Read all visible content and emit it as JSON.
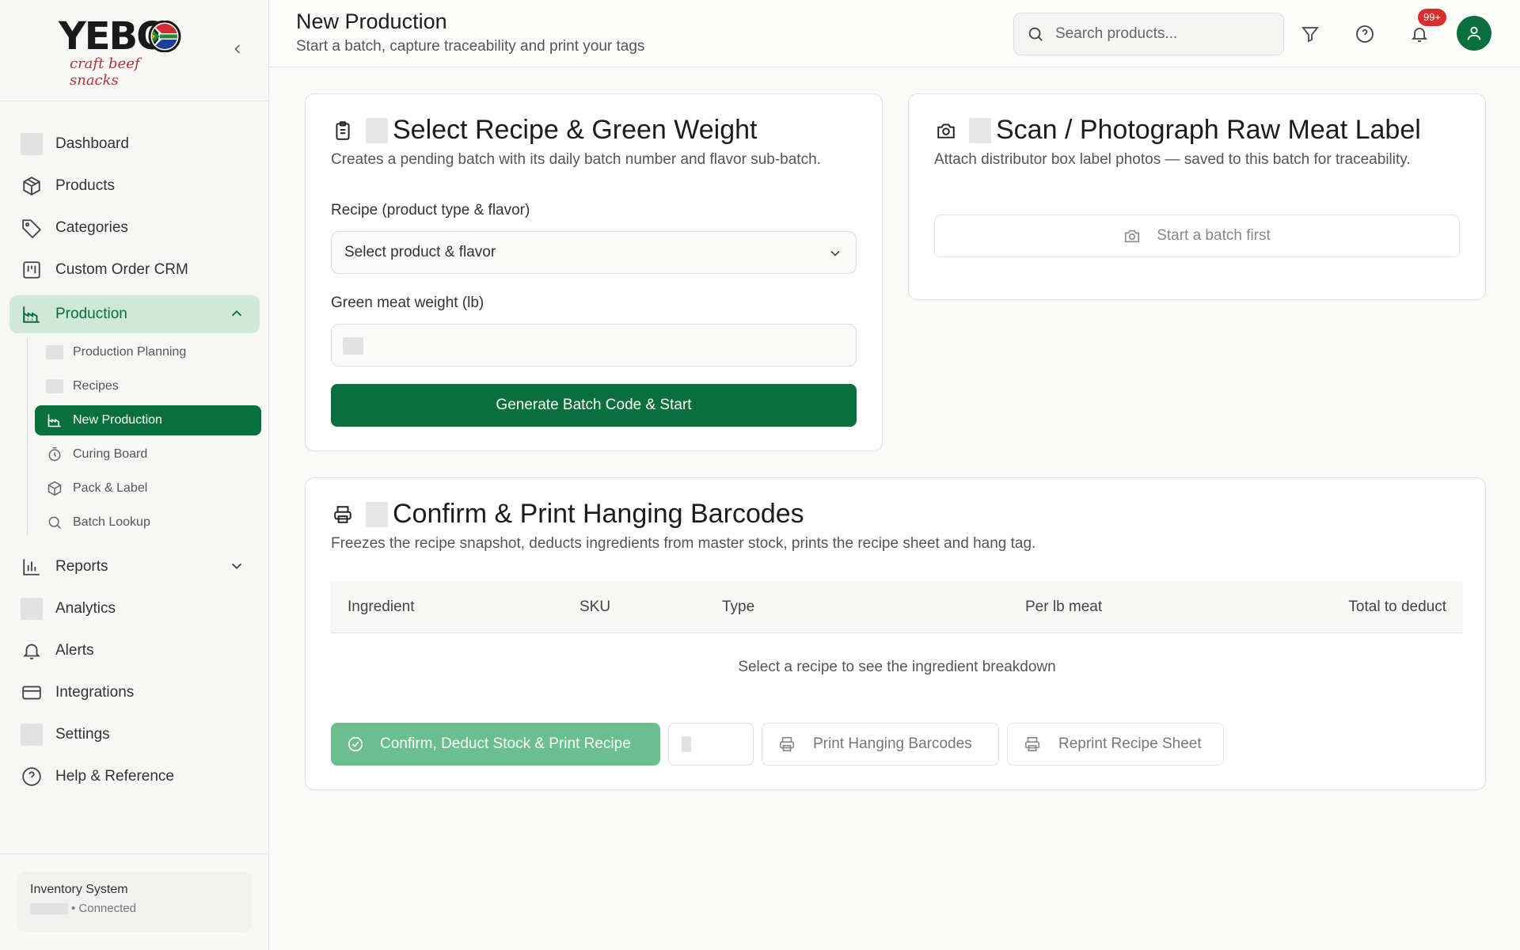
{
  "brand": {
    "wordmark": "YEBO",
    "tagline": "craft beef snacks"
  },
  "sidebar": {
    "items": [
      {
        "label": "Dashboard",
        "icon": "placeholder-icon"
      },
      {
        "label": "Products",
        "icon": "box-icon"
      },
      {
        "label": "Categories",
        "icon": "tag-icon"
      },
      {
        "label": "Custom Order CRM",
        "icon": "kanban-icon"
      },
      {
        "label": "Production",
        "icon": "factory-icon",
        "active": true,
        "expanded": true
      },
      {
        "label": "Reports",
        "icon": "bar-chart-icon"
      },
      {
        "label": "Analytics",
        "icon": "placeholder-icon"
      },
      {
        "label": "Alerts",
        "icon": "bell-icon"
      },
      {
        "label": "Integrations",
        "icon": "card-icon"
      },
      {
        "label": "Settings",
        "icon": "placeholder-icon"
      },
      {
        "label": "Help & Reference",
        "icon": "help-circle-icon"
      }
    ],
    "production_subitems": [
      {
        "label": "Production Planning",
        "icon": "placeholder-icon"
      },
      {
        "label": "Recipes",
        "icon": "placeholder-icon"
      },
      {
        "label": "New Production",
        "icon": "factory-icon",
        "active": true
      },
      {
        "label": "Curing Board",
        "icon": "timer-icon"
      },
      {
        "label": "Pack & Label",
        "icon": "package-icon"
      },
      {
        "label": "Batch Lookup",
        "icon": "search-icon"
      }
    ],
    "footer": {
      "title": "Inventory System",
      "status": "• Connected"
    }
  },
  "header": {
    "title": "New Production",
    "subtitle": "Start a batch, capture traceability and print your tags",
    "search_placeholder": "Search products...",
    "notification_badge": "99+"
  },
  "recipe_card": {
    "title": "Select Recipe & Green Weight",
    "description": "Creates a pending batch with its daily batch number and flavor sub-batch.",
    "recipe_label": "Recipe (product type & flavor)",
    "recipe_value": "Select product & flavor",
    "weight_label": "Green meat weight (lb)",
    "weight_value": "",
    "button": "Generate Batch Code & Start"
  },
  "scan_card": {
    "title": "Scan / Photograph Raw Meat Label",
    "description": "Attach distributor box label photos — saved to this batch for traceability.",
    "button": "Start a batch first"
  },
  "confirm_card": {
    "title": "Confirm & Print Hanging Barcodes",
    "description": "Freezes the recipe snapshot, deducts ingredients from master stock, prints the recipe sheet and hang tag.",
    "columns": [
      "Ingredient",
      "SKU",
      "Type",
      "Per lb meat",
      "Total to deduct"
    ],
    "rows": [],
    "empty_message": "Select a recipe to see the ingredient breakdown",
    "confirm_button": "Confirm, Deduct Stock & Print Recipe",
    "print_barcodes_button": "Print Hanging Barcodes",
    "reprint_button": "Reprint Recipe Sheet"
  },
  "colors": {
    "brand_green": "#09703d",
    "active_bg": "#cfe8da",
    "confirm_disabled": "#6bbf8e",
    "badge_red": "#d92d2d"
  }
}
